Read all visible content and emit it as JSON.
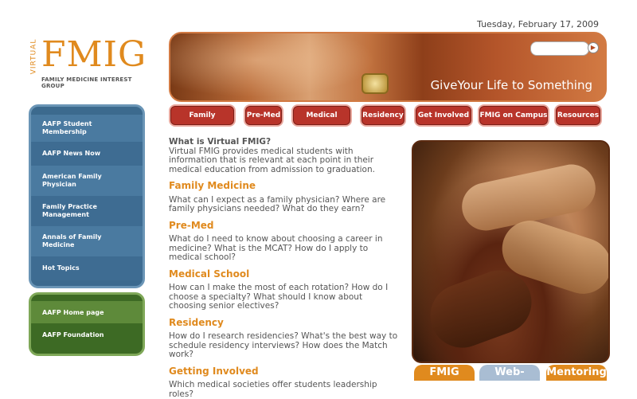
{
  "date": "Tuesday, February 17, 2009",
  "logo": {
    "virtual": "VIRTUAL",
    "name": "FMIG",
    "tagline": "FAMILY MEDICINE INTEREST GROUP"
  },
  "hero": {
    "slogan": "GiveYour Life to Something",
    "search_placeholder": "",
    "search_go_icon": "arrow-right-icon"
  },
  "tabs": [
    "Family Medicine",
    "Pre-Med",
    "Medical School",
    "Residency",
    "Get Involved",
    "FMIG on Campus",
    "Resources"
  ],
  "nav_primary": [
    "AAFP Student Membership",
    "AAFP News Now",
    "American Family Physician",
    "Family Practice Management",
    "Annals of Family Medicine",
    "Hot Topics"
  ],
  "nav_secondary": [
    "AAFP Home page",
    "AAFP Foundation"
  ],
  "main": {
    "intro_title": "What is Virtual FMIG?",
    "intro_text": "Virtual FMIG provides medical students with information that is relevant at each point in their medical education from admission to graduation.",
    "sections": [
      {
        "heading": "Family Medicine",
        "text": "What can I expect as a family physician? Where are family physicians needed? What do they earn?"
      },
      {
        "heading": "Pre-Med",
        "text": "What do I need to know about choosing a career in medicine? What is the MCAT? How do I apply to medical school?"
      },
      {
        "heading": "Medical School",
        "text": "How can I make the most of each rotation? How do I choose a specialty? What should I know about choosing senior electives?"
      },
      {
        "heading": "Residency",
        "text": "How do I research residencies? What's the best way to schedule residency interviews? How does the Match work?"
      },
      {
        "heading": "Getting Involved",
        "text": "Which medical societies offer students leadership roles?"
      }
    ]
  },
  "badges": [
    "FMIG",
    "Web-based",
    "Mentoring"
  ],
  "colors": {
    "orange": "#e08a1e",
    "tab_red": "#b8342a",
    "nav_blue": "#3c6a8e",
    "nav_green": "#3d6a24"
  }
}
